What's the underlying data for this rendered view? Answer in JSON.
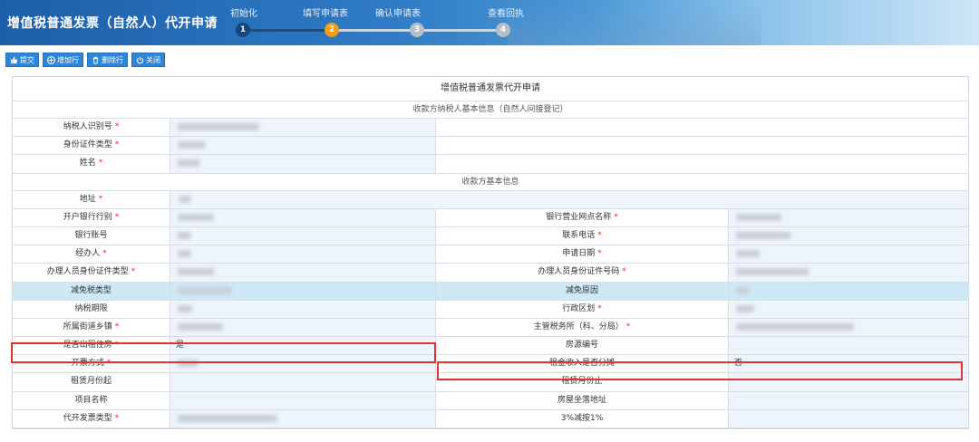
{
  "header": {
    "title": "增值税普通发票（自然人）代开申请",
    "steps": [
      {
        "label": "初始化",
        "number": "1",
        "state": "done"
      },
      {
        "label": "填写申请表",
        "number": "2",
        "state": "active"
      },
      {
        "label": "确认申请表",
        "number": "3",
        "state": "pending"
      },
      {
        "label": "查看回执",
        "number": "4",
        "state": "pending"
      }
    ]
  },
  "toolbar": {
    "submit_label": "提交",
    "add_row_label": "增加行",
    "delete_row_label": "删除行",
    "close_label": "关闭"
  },
  "form": {
    "title": "增值税普通发票代开申请",
    "section1_title": "收款方纳税人基本信息（自然人间接登记）",
    "section2_title": "收款方基本信息",
    "section1_rows": [
      {
        "label": "纳税人识别号",
        "required": true
      },
      {
        "label": "身份证件类型",
        "required": true
      },
      {
        "label": "姓名",
        "required": true
      }
    ],
    "address_label": "地址",
    "rows": [
      {
        "label": "开户银行行别",
        "required": true,
        "label2": "银行营业网点名称",
        "required2": true
      },
      {
        "label": "银行账号",
        "required": false,
        "label2": "联系电话",
        "required2": true
      },
      {
        "label": "经办人",
        "required": true,
        "label2": "申请日期",
        "required2": true
      },
      {
        "label": "办理人员身份证件类型",
        "required": true,
        "label2": "办理人员身份证件号码",
        "required2": true
      },
      {
        "label": "减免税类型",
        "required": false,
        "label2": "减免原因",
        "required2": false,
        "highlight": true
      },
      {
        "label": "纳税期限",
        "required": false,
        "label2": "行政区划",
        "required2": true
      },
      {
        "label": "所属街道乡镇",
        "required": true,
        "label2": "主管税务所（科、分局）",
        "required2": true
      },
      {
        "label": "是否出租住房",
        "required": true,
        "value": "是",
        "label2": "房源编号",
        "required2": false
      },
      {
        "label": "开票方式",
        "required": true,
        "label2": "租金收入是否分摊",
        "required2": false,
        "value2": "否"
      },
      {
        "label": "租赁月份起",
        "required": false,
        "label2": "租赁月份止",
        "required2": false
      },
      {
        "label": "项目名称",
        "required": false,
        "label2": "房屋坐落地址",
        "required2": false
      },
      {
        "label": "代开发票类型",
        "required": true,
        "label2": "3%减按1%",
        "required2": false
      }
    ],
    "required_mark": "*"
  }
}
